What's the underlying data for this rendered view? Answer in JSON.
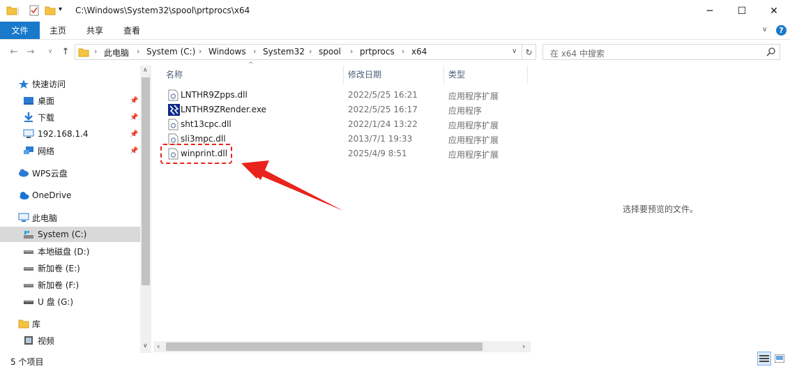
{
  "titlebar": {
    "path": "C:\\Windows\\System32\\spool\\prtprocs\\x64",
    "minimize_icon": "minimize-icon",
    "maximize_icon": "maximize-icon",
    "close_icon": "close-icon"
  },
  "ribbon": {
    "tabs": [
      "文件",
      "主页",
      "共享",
      "查看"
    ],
    "accent": "#1979ca"
  },
  "address": {
    "crumbs": [
      "此电脑",
      "System (C:)",
      "Windows",
      "System32",
      "spool",
      "prtprocs",
      "x64"
    ]
  },
  "search": {
    "placeholder": "在 x64 中搜索"
  },
  "nav": {
    "quick_access": "快速访问",
    "items": [
      {
        "label": "桌面",
        "pinned": true
      },
      {
        "label": "下载",
        "pinned": true
      },
      {
        "label": "192.168.1.4",
        "pinned": true
      },
      {
        "label": "网络",
        "pinned": true
      }
    ],
    "wps": "WPS云盘",
    "onedrive": "OneDrive",
    "this_pc": "此电脑",
    "drives": [
      {
        "label": "System (C:)",
        "selected": true
      },
      {
        "label": "本地磁盘 (D:)"
      },
      {
        "label": "新加卷 (E:)"
      },
      {
        "label": "新加卷 (F:)"
      },
      {
        "label": "U 盘 (G:)"
      }
    ],
    "library": "库",
    "video": "视频"
  },
  "columns": {
    "name": "名称",
    "date": "修改日期",
    "type": "类型"
  },
  "files": [
    {
      "name": "LNTHR9Zpps.dll",
      "date": "2022/5/25 16:21",
      "type": "应用程序扩展",
      "icon": "dll-file-icon"
    },
    {
      "name": "LNTHR9ZRender.exe",
      "date": "2022/5/25 16:17",
      "type": "应用程序",
      "icon": "exe-app-icon"
    },
    {
      "name": "sht13cpc.dll",
      "date": "2022/1/24 13:22",
      "type": "应用程序扩展",
      "icon": "dll-file-icon"
    },
    {
      "name": "sli3mpc.dll",
      "date": "2013/7/1 19:33",
      "type": "应用程序扩展",
      "icon": "dll-file-icon"
    },
    {
      "name": "winprint.dll",
      "date": "2025/4/9 8:51",
      "type": "应用程序扩展",
      "icon": "dll-file-icon"
    }
  ],
  "preview": {
    "message": "选择要预览的文件。"
  },
  "status": {
    "count": "5 个项目"
  },
  "annotation": {
    "color": "#e8241c"
  }
}
